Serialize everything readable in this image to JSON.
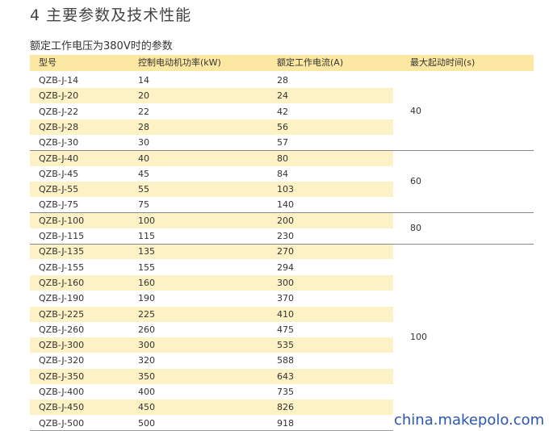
{
  "section_title": "4 主要参数及技术性能",
  "table_caption": "额定工作电压为380V时的参数",
  "headers": [
    "型号",
    "控制电动机功率(kW)",
    "额定工作电流(A)",
    "最大起动时间(s)"
  ],
  "rows": [
    {
      "model": "QZB-J-14",
      "power": "14",
      "current": "28"
    },
    {
      "model": "QZB-J-20",
      "power": "20",
      "current": "24"
    },
    {
      "model": "QZB-J-22",
      "power": "22",
      "current": "42"
    },
    {
      "model": "QZB-J-28",
      "power": "28",
      "current": "56"
    },
    {
      "model": "QZB-J-30",
      "power": "30",
      "current": "57"
    },
    {
      "model": "QZB-J-40",
      "power": "40",
      "current": "80"
    },
    {
      "model": "QZB-J-45",
      "power": "45",
      "current": "84"
    },
    {
      "model": "QZB-J-55",
      "power": "55",
      "current": "103"
    },
    {
      "model": "QZB-J-75",
      "power": "75",
      "current": "140"
    },
    {
      "model": "QZB-J-100",
      "power": "100",
      "current": "200"
    },
    {
      "model": "QZB-J-115",
      "power": "115",
      "current": "230"
    },
    {
      "model": "QZB-J-135",
      "power": "135",
      "current": "270"
    },
    {
      "model": "QZB-J-155",
      "power": "155",
      "current": "294"
    },
    {
      "model": "QZB-J-160",
      "power": "160",
      "current": "300"
    },
    {
      "model": "QZB-J-190",
      "power": "190",
      "current": "370"
    },
    {
      "model": "QZB-J-225",
      "power": "225",
      "current": "410"
    },
    {
      "model": "QZB-J-260",
      "power": "260",
      "current": "475"
    },
    {
      "model": "QZB-J-300",
      "power": "300",
      "current": "535"
    },
    {
      "model": "QZB-J-320",
      "power": "320",
      "current": "588"
    },
    {
      "model": "QZB-J-350",
      "power": "350",
      "current": "643"
    },
    {
      "model": "QZB-J-400",
      "power": "400",
      "current": "735"
    },
    {
      "model": "QZB-J-450",
      "power": "450",
      "current": "826"
    },
    {
      "model": "QZB-J-500",
      "power": "500",
      "current": "918"
    }
  ],
  "time_groups": [
    {
      "value": "40",
      "row_count": 5
    },
    {
      "value": "60",
      "row_count": 4
    },
    {
      "value": "80",
      "row_count": 2
    },
    {
      "value": "100",
      "row_count": 12
    }
  ],
  "watermark": "china.makepolo.com",
  "colors": {
    "header_bg": "#fce7a3",
    "stripe_bg": "#fdf2c5",
    "watermark": "#2a55b0"
  }
}
